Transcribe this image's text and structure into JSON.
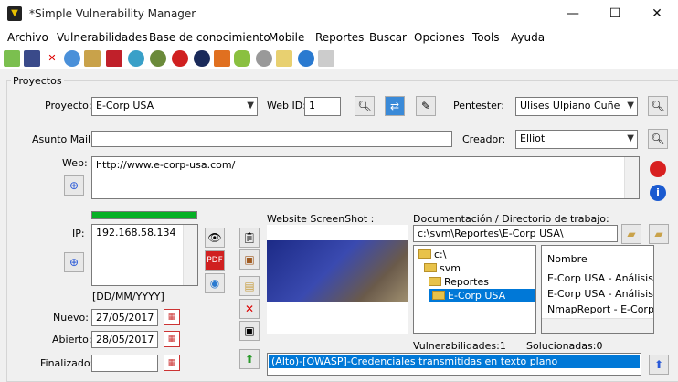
{
  "window": {
    "title": "*Simple Vulnerability Manager",
    "minimize": "—",
    "maximize": "☐",
    "close": "✕"
  },
  "menu": [
    "Archivo",
    "Vulnerabilidades",
    "Base de conocimiento",
    "Mobile",
    "Reportes",
    "Buscar",
    "Opciones",
    "Tools",
    "Ayuda"
  ],
  "toolbar_icons": [
    "new-icon",
    "save-icon",
    "delete-icon",
    "refresh-icon",
    "copy-icon",
    "shield-icon",
    "cycle-icon",
    "bug-icon",
    "target-icon",
    "globe-dark-icon",
    "lightning-icon",
    "android-icon",
    "gear-icon",
    "edit-icon",
    "web-icon",
    "export-icon"
  ],
  "group": {
    "title": "Proyectos"
  },
  "proyecto": {
    "label": "Proyecto:",
    "value": "E-Corp USA"
  },
  "webid": {
    "label": "Web ID:",
    "value": "1"
  },
  "pentester": {
    "label": "Pentester:",
    "value": "Ulises Ulpiano Cuñe"
  },
  "asunto": {
    "label": "Asunto Mail:",
    "value": ""
  },
  "creador": {
    "label": "Creador:",
    "value": "Elliot"
  },
  "web": {
    "label": "Web:",
    "value": "http://www.e-corp-usa.com/"
  },
  "ip": {
    "label": "IP:",
    "value": "192.168.58.134",
    "progress": 1.0
  },
  "date_format": "[DD/MM/YYYY]",
  "dates": {
    "nuevo": {
      "label": "Nuevo:",
      "value": "27/05/2017"
    },
    "abierto": {
      "label": "Abierto:",
      "value": "28/05/2017"
    },
    "finalizado": {
      "label": "Finalizado:",
      "value": ""
    }
  },
  "screenshot": {
    "label": "Website ScreenShot :"
  },
  "docs": {
    "label": "Documentación / Directorio de trabajo:",
    "path": "c:\\svm\\Reportes\\E-Corp USA\\",
    "tree": [
      "c:\\",
      "svm",
      "Reportes",
      "E-Corp USA"
    ],
    "files_header": "Nombre",
    "files": [
      "E-Corp USA - Análisis de",
      "E-Corp USA - Análisis de",
      "NmapReport - E-Corp US"
    ]
  },
  "vulns": {
    "label": "Vulnerabilidades:1",
    "solved": "Solucionadas:0",
    "items": [
      "(Alto)-[OWASP]-Credenciales transmitidas en texto plano"
    ]
  }
}
